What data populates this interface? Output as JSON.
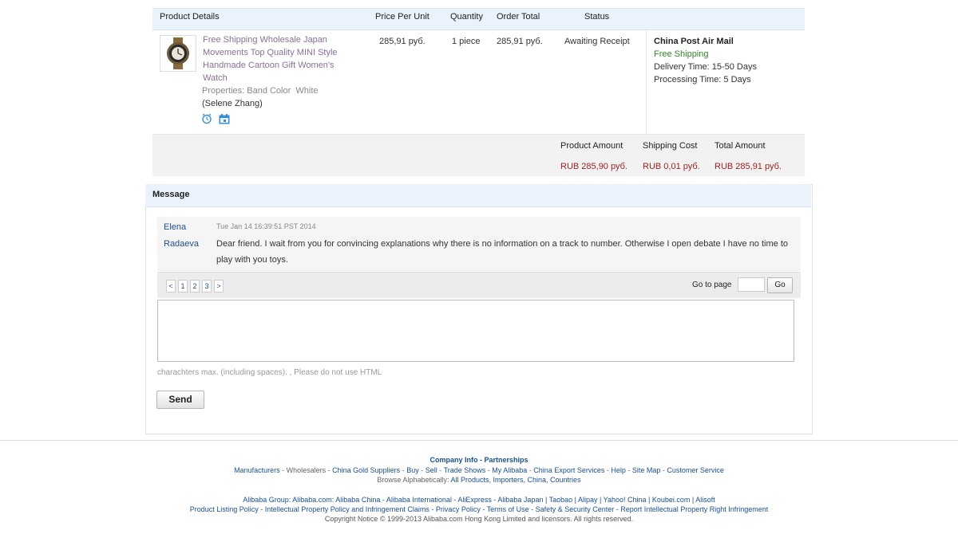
{
  "order": {
    "headers": {
      "product_details": "Product Details",
      "price_per_unit": "Price Per Unit",
      "quantity": "Quantity",
      "order_total": "Order Total",
      "status": "Status"
    },
    "product": {
      "title": "Free Shipping Wholesale Japan Movements Top Quality MINI Style Handmade Cartoon Gift Women's Watch",
      "properties_label": "Properties: Band Color",
      "properties_value": "White",
      "seller": "(Selene Zhang)",
      "icon_1": "alarm-clock-icon",
      "icon_2": "calendar-icon",
      "price_per_unit": "285,91 руб.",
      "quantity": "1 piece",
      "order_total": "285,91 руб.",
      "status": "Awaiting Receipt"
    },
    "shipping": {
      "method": "China Post Air Mail",
      "free": "Free Shipping",
      "delivery_time": "Delivery Time:  15-50 Days",
      "processing_time": "Processing Time:  5 Days"
    },
    "summary": {
      "product_amount_label": "Product Amount",
      "shipping_cost_label": "Shipping Cost",
      "total_amount_label": "Total Amount",
      "product_amount": "RUB 285,90 руб.",
      "shipping_cost": "RUB 0,01 руб.",
      "total_amount": "RUB 285,91 руб."
    }
  },
  "message": {
    "title": "Message",
    "author_first": "Elena",
    "author_last": "Radaeva",
    "timestamp": "Tue Jan 14 16:39:51 PST 2014",
    "text": "Dear friend. I wait from you for convincing explanations why there is no information on a track to number. Otherwise I open debate I have no time to play with you toys.",
    "pager": {
      "prev": "<",
      "pages": [
        "1",
        "2",
        "3"
      ],
      "next": ">",
      "goto_label": "Go to page",
      "go_button": "Go"
    },
    "hint": "charachters max. (including spaces). , Please do not use HTML",
    "send_button": "Send"
  },
  "footer": {
    "line1": "Company Info - Partnerships",
    "line2": [
      "Manufacturers",
      " - ",
      "Wholesalers",
      " - ",
      "China Gold Suppliers",
      " - ",
      "Buy",
      " - ",
      "Sell",
      " - ",
      "Trade Shows",
      " - ",
      "My Alibaba",
      " - ",
      "China Export Services",
      " - ",
      "Help",
      " - ",
      "Site Map",
      " - ",
      "Customer Service"
    ],
    "line3_label": "Browse Alphabetically:",
    "line3_links": "All Products, Importers, China, Countries",
    "line4": "Alibaba Group: Alibaba.com: Alibaba China - Alibaba International - AliExpress - Alibaba Japan | Taobao | Alipay | Yahoo! China | Koubei.com | Alisoft",
    "line5": "Product Listing Policy - Intellectual Property Policy and Infringement Claims - Privacy Policy - Terms of Use - Safety & Security Center - Report Intellectual Property Right Infringement",
    "line6": "Copyright Notice © 1999-2013 Alibaba.com Hong Kong Limited and licensors. All rights reserved."
  },
  "colors": {
    "accent_link": "#1a4f8f",
    "product_title": "#8a6f96",
    "price_red": "#9a1f1f",
    "free_shipping_green": "#2d8a1f",
    "header_bg": "#eaf3fb"
  }
}
